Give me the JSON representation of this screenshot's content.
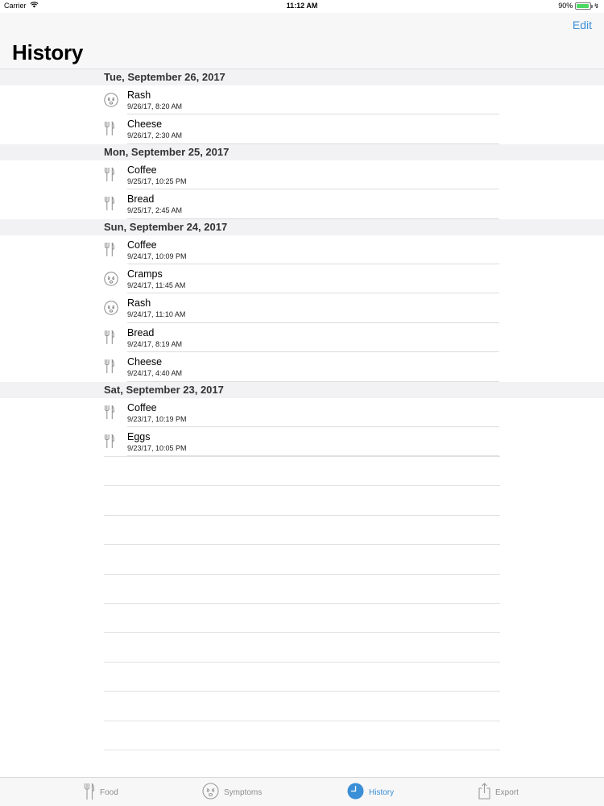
{
  "status_bar": {
    "carrier": "Carrier",
    "time": "11:12 AM",
    "battery": "90%",
    "battery_level": 0.9
  },
  "nav": {
    "edit_label": "Edit",
    "title": "History"
  },
  "sections": [
    {
      "header": "Tue, September 26, 2017",
      "items": [
        {
          "type": "symptom",
          "icon": "face-icon",
          "title": "Rash",
          "timestamp": "9/26/17, 8:20 AM"
        },
        {
          "type": "food",
          "icon": "fork-knife-icon",
          "title": "Cheese",
          "timestamp": "9/26/17, 2:30 AM"
        }
      ]
    },
    {
      "header": "Mon, September 25, 2017",
      "items": [
        {
          "type": "food",
          "icon": "fork-knife-icon",
          "title": "Coffee",
          "timestamp": "9/25/17, 10:25 PM"
        },
        {
          "type": "food",
          "icon": "fork-knife-icon",
          "title": "Bread",
          "timestamp": "9/25/17, 2:45 AM"
        }
      ]
    },
    {
      "header": "Sun, September 24, 2017",
      "items": [
        {
          "type": "food",
          "icon": "fork-knife-icon",
          "title": "Coffee",
          "timestamp": "9/24/17, 10:09 PM"
        },
        {
          "type": "symptom",
          "icon": "face-icon",
          "title": "Cramps",
          "timestamp": "9/24/17, 11:45 AM"
        },
        {
          "type": "symptom",
          "icon": "face-icon",
          "title": "Rash",
          "timestamp": "9/24/17, 11:10 AM"
        },
        {
          "type": "food",
          "icon": "fork-knife-icon",
          "title": "Bread",
          "timestamp": "9/24/17, 8:19 AM"
        },
        {
          "type": "food",
          "icon": "fork-knife-icon",
          "title": "Cheese",
          "timestamp": "9/24/17, 4:40 AM"
        }
      ]
    },
    {
      "header": "Sat, September 23, 2017",
      "items": [
        {
          "type": "food",
          "icon": "fork-knife-icon",
          "title": "Coffee",
          "timestamp": "9/23/17, 10:19 PM"
        },
        {
          "type": "food",
          "icon": "fork-knife-icon",
          "title": "Eggs",
          "timestamp": "9/23/17, 10:05 PM"
        }
      ]
    }
  ],
  "tabs": [
    {
      "label": "Food",
      "icon": "fork-knife-icon",
      "active": false
    },
    {
      "label": "Symptoms",
      "icon": "face-icon",
      "active": false
    },
    {
      "label": "History",
      "icon": "clock-icon",
      "active": true
    },
    {
      "label": "Export",
      "icon": "share-icon",
      "active": false
    }
  ],
  "colors": {
    "accent": "#3b8fd6",
    "battery": "#4cd964",
    "section_bg": "#f2f2f4",
    "nav_bg": "#f7f7f7"
  }
}
